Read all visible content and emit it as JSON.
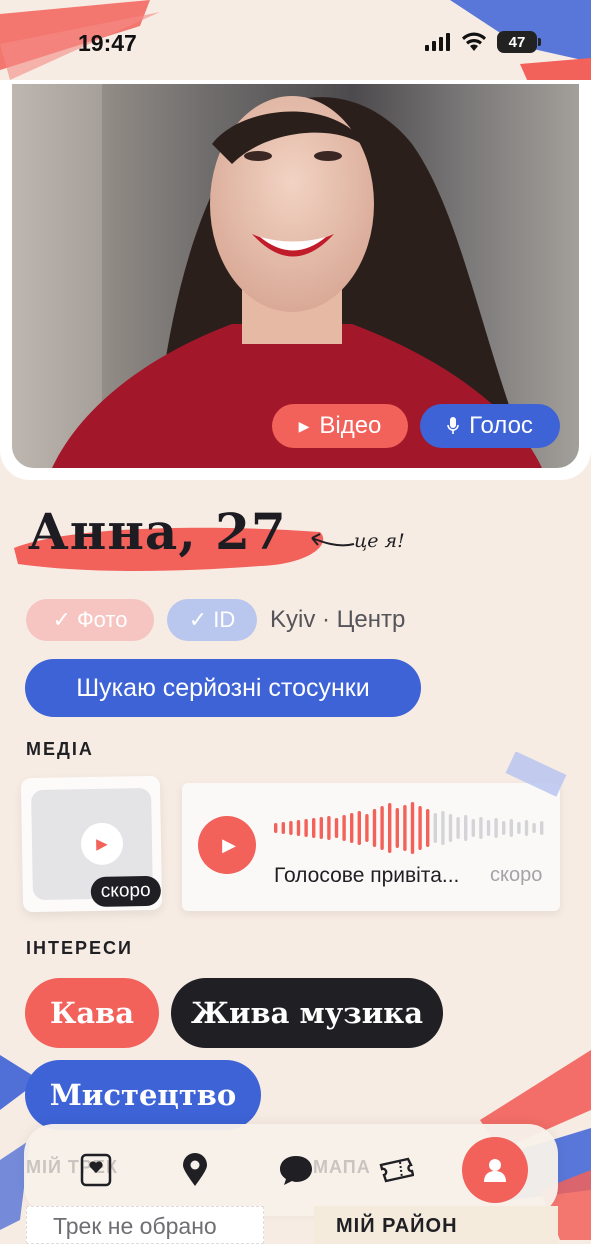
{
  "status": {
    "time": "19:47",
    "battery": "47"
  },
  "hero": {
    "video_label": "Відео",
    "voice_label": "Голос"
  },
  "profile": {
    "name": "Анна, 27",
    "note": "це я!",
    "badge_photo": "Фото",
    "badge_id": "ID",
    "location": "Kyiv · Центр",
    "intent": "Шукаю серйозні стосунки"
  },
  "media": {
    "title": "МЕДІА",
    "video_soon": "скоро",
    "voice_label": "Голосове привіта...",
    "voice_soon": "скоро"
  },
  "interests": {
    "title": "ІНТЕРЕСИ",
    "items": [
      "Кава",
      "Жива музика",
      "Мистецтво"
    ]
  },
  "nav": {
    "track_label": "МІЙ ТРЕК",
    "map_label": "МАПА",
    "track_status": "Трек не обрано",
    "district": "МІЙ РАЙОН"
  },
  "colors": {
    "coral": "#f2615a",
    "blue": "#3d63d6",
    "dark": "#1f1f24",
    "background": "#f7ece4"
  }
}
